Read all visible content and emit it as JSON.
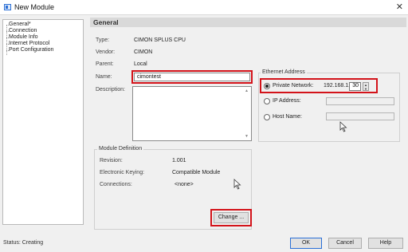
{
  "window": {
    "title": "New Module",
    "close_glyph": "✕"
  },
  "tree": {
    "items": [
      {
        "label": "General*"
      },
      {
        "label": "Connection"
      },
      {
        "label": "Module Info"
      },
      {
        "label": "Internet Protocol"
      },
      {
        "label": "Port Configuration"
      }
    ]
  },
  "panel": {
    "title": "General"
  },
  "fields": {
    "type_label": "Type:",
    "type_value": "CIMON SPLUS CPU",
    "vendor_label": "Vendor:",
    "vendor_value": "CIMON",
    "parent_label": "Parent:",
    "parent_value": "Local",
    "name_label": "Name:",
    "name_value": "cimontest",
    "description_label": "Description:",
    "description_value": ""
  },
  "ethernet": {
    "group_label": "Ethernet Address",
    "private_label": "Private Network:",
    "private_prefix": "192.168.1.",
    "private_octet": "30",
    "ip_label": "IP Address:",
    "host_label": "Host Name:",
    "selected": "private"
  },
  "module_def": {
    "group_label": "Module Definition",
    "revision_label": "Revision:",
    "revision_value": "1.001",
    "keying_label": "Electronic Keying:",
    "keying_value": "Compatible Module",
    "connections_label": "Connections:",
    "connections_value": "<none>",
    "change_label": "Change ..."
  },
  "footer": {
    "status": "Status: Creating",
    "ok_label": "OK",
    "cancel_label": "Cancel",
    "help_label": "Help"
  },
  "colors": {
    "highlight": "#d3131a",
    "header_bg": "#d9d9d9",
    "window_bg": "#f0f0f0"
  },
  "icons": [
    "app-window-icon",
    "close-icon",
    "radio-selected-icon",
    "spin-up-icon",
    "spin-down-icon",
    "mouse-cursor-icon"
  ]
}
